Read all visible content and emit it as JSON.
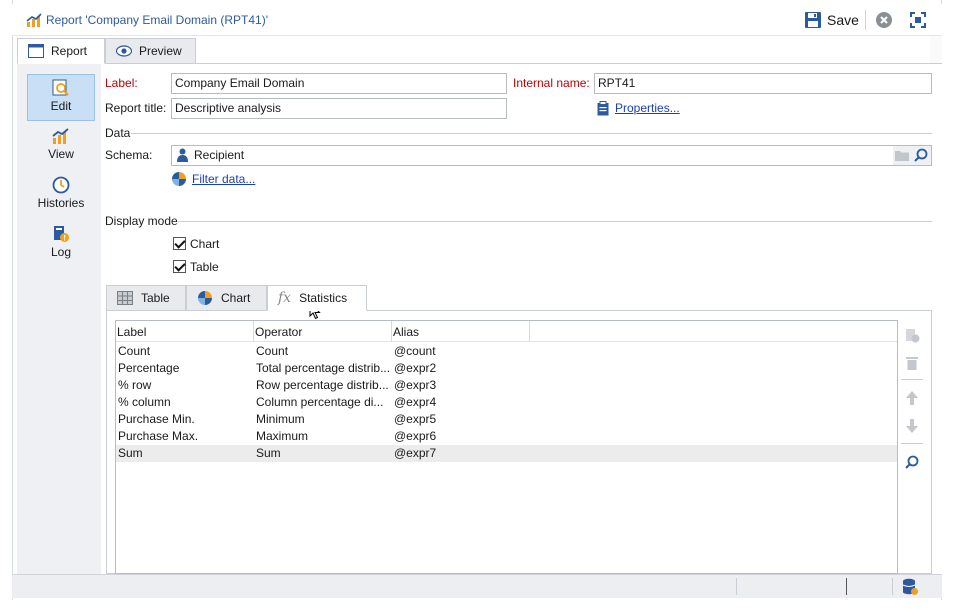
{
  "window": {
    "title": "Report 'Company Email Domain (RPT41)'"
  },
  "toolbar": {
    "save_label": "Save"
  },
  "top_tabs": [
    {
      "label": "Report",
      "active": true
    },
    {
      "label": "Preview",
      "active": false
    }
  ],
  "nav": [
    {
      "label": "Edit",
      "icon": "edit-report-icon",
      "active": true
    },
    {
      "label": "View",
      "icon": "chart-view-icon",
      "active": false
    },
    {
      "label": "Histories",
      "icon": "clock-icon",
      "active": false
    },
    {
      "label": "Log",
      "icon": "log-icon",
      "active": false
    }
  ],
  "form": {
    "label_caption": "Label:",
    "label_value": "Company Email Domain",
    "internal_name_caption": "Internal name:",
    "internal_name_value": "RPT41",
    "report_title_caption": "Report title:",
    "report_title_value": "Descriptive analysis",
    "properties_link": "Properties...",
    "data_section": "Data",
    "schema_caption": "Schema:",
    "schema_value": "Recipient",
    "filter_link": "Filter data...",
    "display_mode_section": "Display mode",
    "chart_checkbox": {
      "label": "Chart",
      "checked": true
    },
    "table_checkbox": {
      "label": "Table",
      "checked": true
    }
  },
  "sub_tabs": [
    {
      "label": "Table",
      "active": false
    },
    {
      "label": "Chart",
      "active": false
    },
    {
      "label": "Statistics",
      "active": true
    }
  ],
  "grid": {
    "columns": [
      "Label",
      "Operator",
      "Alias"
    ],
    "rows": [
      [
        "Count",
        "Count",
        "@count"
      ],
      [
        "Percentage",
        "Total percentage distrib...",
        "@expr2"
      ],
      [
        "% row",
        "Row percentage distrib...",
        "@expr3"
      ],
      [
        "% column",
        "Column percentage di...",
        "@expr4"
      ],
      [
        "Purchase Min.",
        "Minimum",
        "@expr5"
      ],
      [
        "Purchase Max.",
        "Maximum",
        "@expr6"
      ],
      [
        "Sum",
        "Sum",
        "@expr7"
      ]
    ],
    "selected_row": 6
  },
  "colors": {
    "accent": "#2c5aa0",
    "required_label": "#c00000",
    "link": "#1a3fb5"
  }
}
